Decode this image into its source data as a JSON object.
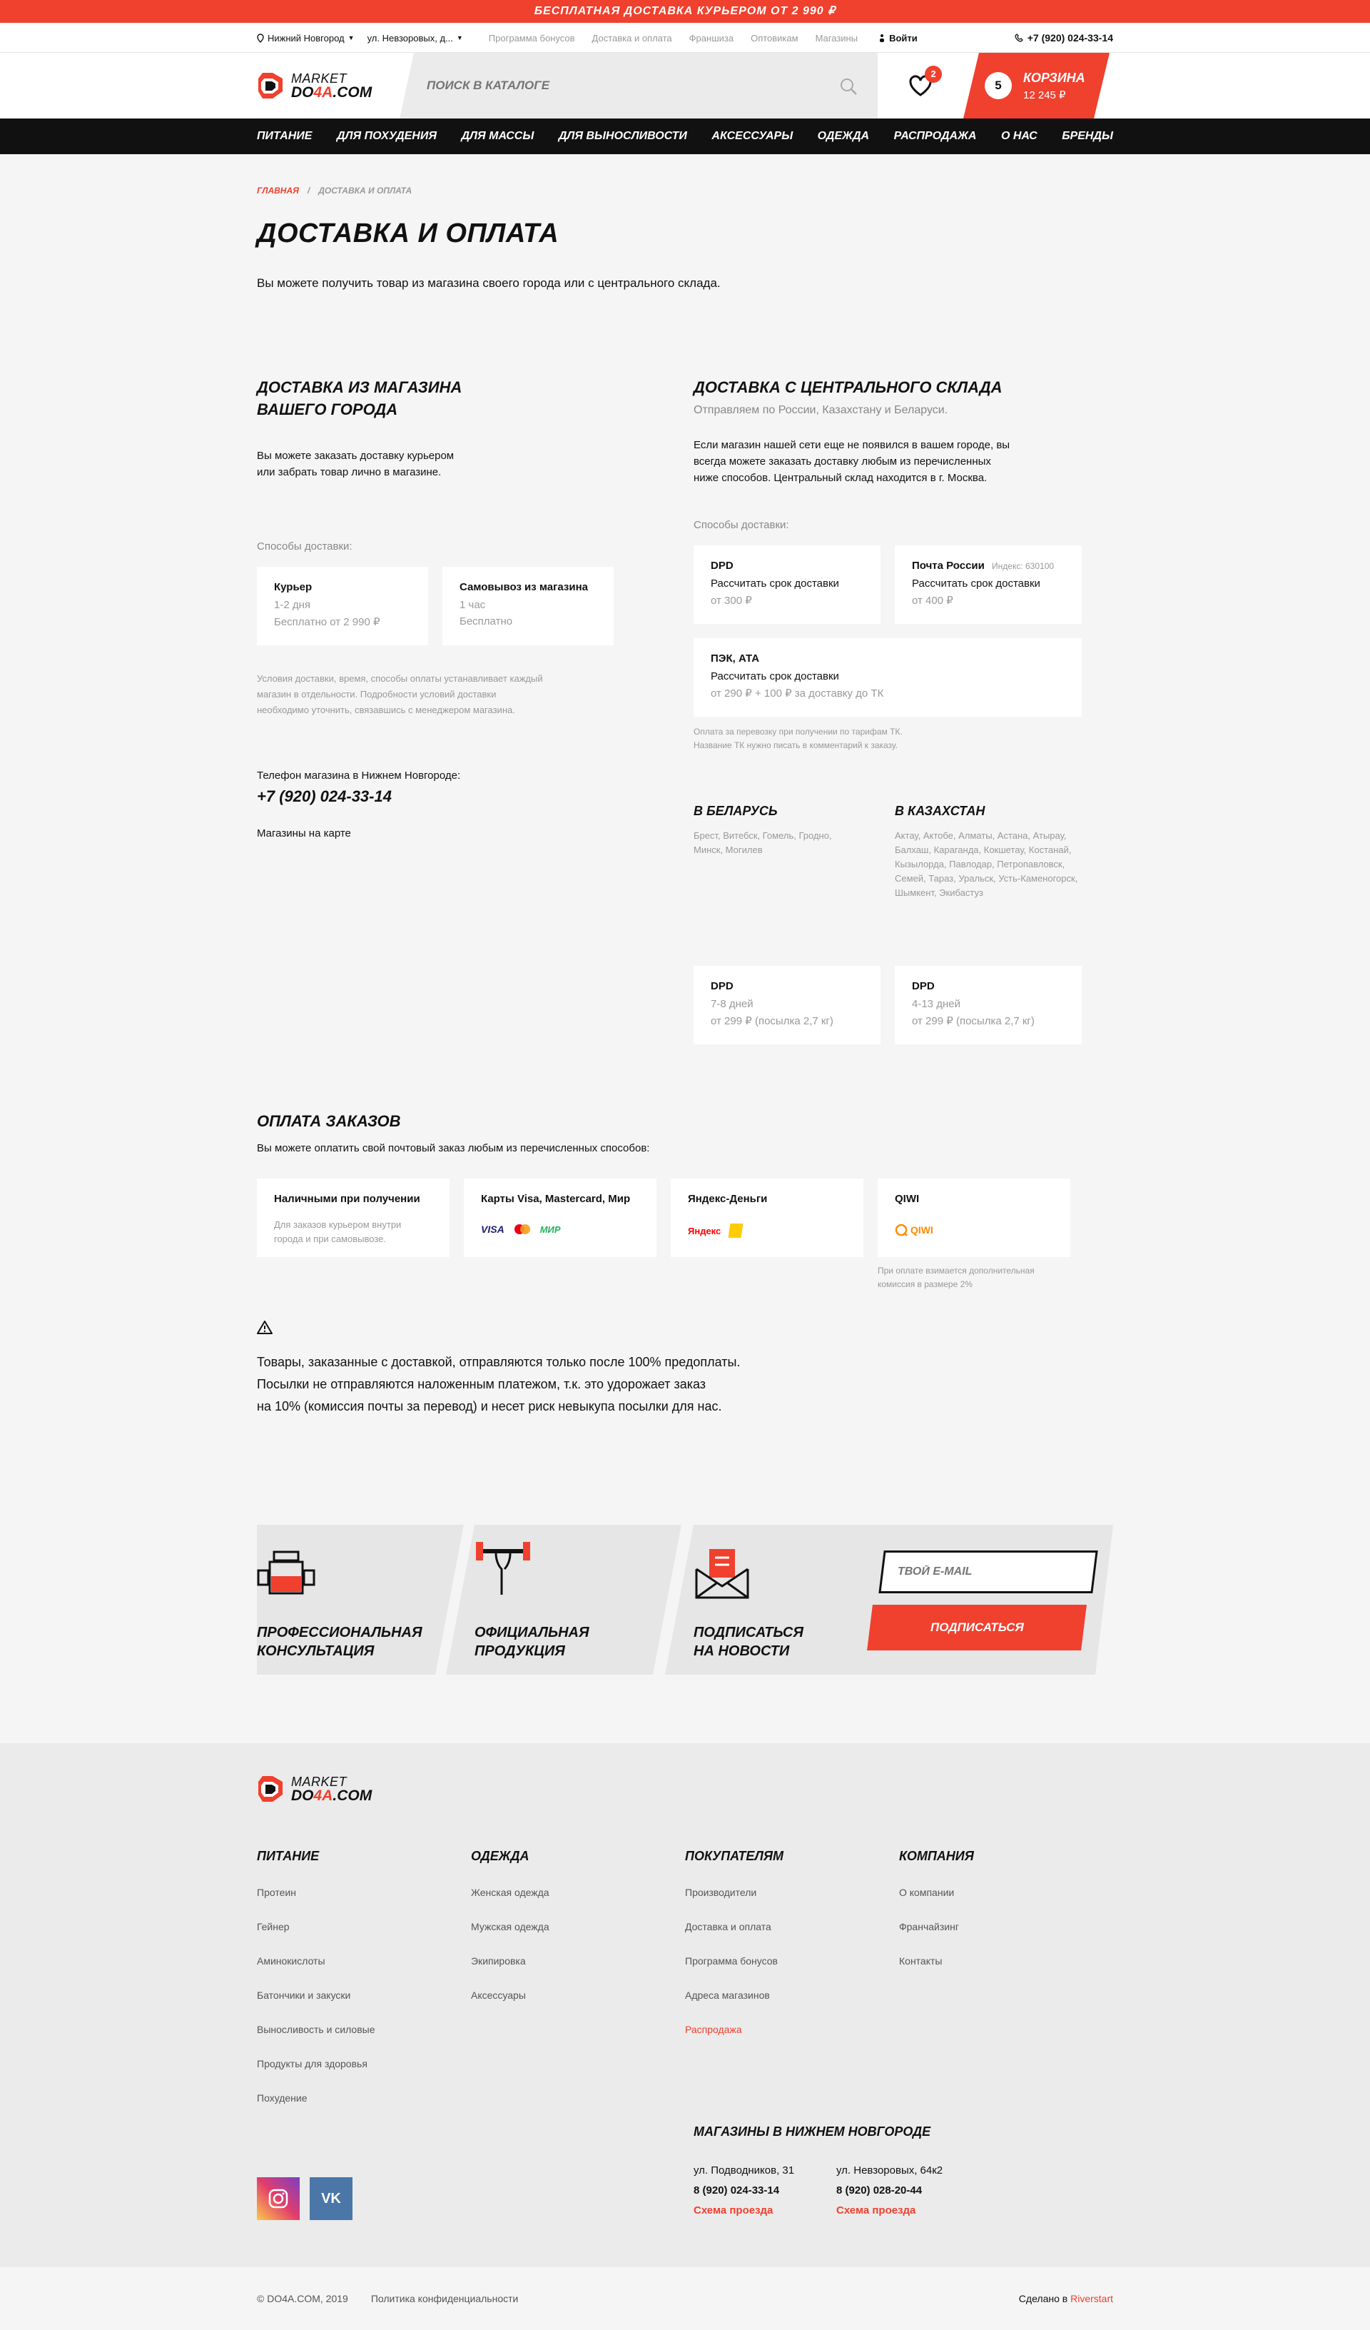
{
  "promo": "БЕСПЛАТНАЯ ДОСТАВКА КУРЬЕРОМ ОТ 2 990 ₽",
  "topbar": {
    "city": "Нижний Новгород",
    "address": "ул. Невзоровых, д...",
    "links": [
      "Программа бонусов",
      "Доставка и оплата",
      "Франшиза",
      "Оптовикам",
      "Магазины"
    ],
    "login": "Войти",
    "phone": "+7 (920) 024-33-14"
  },
  "header": {
    "logo_top": "MARKET",
    "logo_a": "DO",
    "logo_b": "4A",
    "logo_c": ".COM",
    "search_placeholder": "ПОИСК В КАТАЛОГЕ",
    "fav_count": "2",
    "cart_count": "5",
    "cart_label": "КОРЗИНА",
    "cart_sum": "12 245 ₽"
  },
  "nav": [
    "ПИТАНИЕ",
    "ДЛЯ ПОХУДЕНИЯ",
    "ДЛЯ МАССЫ",
    "ДЛЯ ВЫНОСЛИВОСТИ",
    "АКСЕССУАРЫ",
    "ОДЕЖДА",
    "РАСПРОДАЖА",
    "О НАС",
    "БРЕНДЫ"
  ],
  "breadcrumbs": {
    "home": "ГЛАВНАЯ",
    "sep": "/",
    "current": "ДОСТАВКА И ОПЛАТА"
  },
  "page": {
    "title": "ДОСТАВКА И ОПЛАТА",
    "intro": "Вы можете получить товар из магазина своего города или с центрального склада."
  },
  "local": {
    "title1": "ДОСТАВКА ИЗ МАГАЗИНА",
    "title2": "ВАШЕГО ГОРОДА",
    "text1": "Вы можете заказать доставку курьером",
    "text2": "или забрать товар лично в магазине.",
    "methods_label": "Способы доставки:",
    "cards": [
      {
        "title": "Курьер",
        "time": "1-2 дня",
        "price": "Бесплатно от 2 990 ₽"
      },
      {
        "title": "Самовывоз из магазина",
        "time": "1 час",
        "price": "Бесплатно"
      }
    ],
    "note1": "Условия доставки, время, способы оплаты устанавливает каждый",
    "note2": "магазин в отдельности. Подробности условий доставки",
    "note3": "необходимо уточнить, связавшись с менеджером магазина.",
    "phone_label": "Телефон магазина в Нижнем Новгороде:",
    "phone": "+7 (920) 024-33-14",
    "map_link": "Магазины на карте"
  },
  "central": {
    "title": "ДОСТАВКА С ЦЕНТРАЛЬНОГО СКЛАДА",
    "subtitle": "Отправляем по России, Казахстану и Беларуси.",
    "text1": "Если магазин нашей сети еще не появился в вашем городе, вы",
    "text2": "всегда можете заказать доставку любым из перечисленных",
    "text3": "ниже способов. Центральный склад находится в г. Москва.",
    "methods_label": "Способы доставки:",
    "dpd": {
      "title": "DPD",
      "action": "Рассчитать срок доставки",
      "price": "от 300 ₽"
    },
    "post": {
      "title": "Почта России",
      "index": "Индекс: 630100",
      "action": "Рассчитать срок доставки",
      "price": "от 400 ₽"
    },
    "pek": {
      "title": "ПЭК, АТА",
      "action": "Рассчитать срок доставки",
      "price": "от 290 ₽ + 100 ₽ за доставку до ТК"
    },
    "note1": "Оплата за перевозку при получении по тарифам ТК.",
    "note2": "Название ТК нужно писать в комментарий к заказу.",
    "belarus": {
      "title": "В БЕЛАРУСЬ",
      "cities1": "Брест, Витебск, Гомель, Гродно,",
      "cities2": "Минск, Могилев"
    },
    "kz": {
      "title": "В КАЗАХСТАН",
      "c1": "Актау, Актобе, Алматы, Астана, Атырау,",
      "c2": "Балхаш, Караганда, Кокшетау, Костанай,",
      "c3": "Кызылорда, Павлодар, Петропавловск,",
      "c4": "Семей, Тараз, Уральск, Усть-Каменогорск,",
      "c5": "Шымкент, Экибастуз"
    },
    "by_card": {
      "title": "DPD",
      "time": "7-8 дней",
      "price": "от 299 ₽ (посылка 2,7 кг)"
    },
    "kz_card": {
      "title": "DPD",
      "time": "4-13 дней",
      "price": "от 299 ₽ (посылка 2,7 кг)"
    }
  },
  "payment": {
    "title": "ОПЛАТА ЗАКАЗОВ",
    "intro": "Вы можете оплатить свой почтовый заказ любым из перечисленных способов:",
    "cards": [
      {
        "title": "Наличными при получении",
        "s1": "Для заказов курьером внутри",
        "s2": "города и при самовывозе."
      },
      {
        "title": "Карты Visa, Mastercard, Мир",
        "visa": "VISA",
        "mir": "МИР"
      },
      {
        "title": "Яндекс-Деньги",
        "ya": "Яндекс"
      },
      {
        "title": "QIWI",
        "qiwi": "QIWI"
      }
    ],
    "qiwi_note1": "При оплате взимается дополнительная",
    "qiwi_note2": "комиссия в размере 2%"
  },
  "warning": {
    "l1": "Товары, заказанные с доставкой, отправляются только после 100% предоплаты.",
    "l2": "Посылки не отправляются наложенным платежом, т.к. это удорожает заказ",
    "l3": "на 10% (комиссия почты за перевод) и несет риск невыкупа посылки для нас."
  },
  "features": [
    {
      "l1": "ПРОФЕССИОНАЛЬНАЯ",
      "l2": "КОНСУЛЬТАЦИЯ"
    },
    {
      "l1": "ОФИЦИАЛЬНАЯ",
      "l2": "ПРОДУКЦИЯ"
    },
    {
      "l1": "ПОДПИСАТЬСЯ",
      "l2": "НА НОВОСТИ"
    }
  ],
  "subscribe": {
    "placeholder": "ТВОЙ E-MAIL",
    "button": "ПОДПИСАТЬСЯ"
  },
  "footer": {
    "cols": [
      {
        "title": "ПИТАНИЕ",
        "items": [
          "Протеин",
          "Гейнер",
          "Аминокислоты",
          "Батончики и закуски",
          "Выносливость и силовые",
          "Продукты для здоровья",
          "Похудение"
        ]
      },
      {
        "title": "ОДЕЖДА",
        "items": [
          "Женская одежда",
          "Мужская одежда",
          "Экипировка",
          "Аксессуары"
        ]
      },
      {
        "title": "ПОКУПАТЕЛЯМ",
        "items": [
          "Производители",
          "Доставка и оплата",
          "Программа бонусов",
          "Адреса магазинов",
          "Распродажа"
        ]
      },
      {
        "title": "КОМПАНИЯ",
        "items": [
          "О компании",
          "Франчайзинг",
          "Контакты"
        ]
      }
    ],
    "stores_title": "МАГАЗИНЫ В НИЖНЕМ НОВГОРОДЕ",
    "stores": [
      {
        "addr": "ул. Подводников, 31",
        "phone": "8 (920) 024-33-14",
        "link": "Схема проезда"
      },
      {
        "addr": "ул. Невзоровых, 64к2",
        "phone": "8 (920) 028-20-44",
        "link": "Схема проезда"
      }
    ]
  },
  "bottom": {
    "copyright": "© DO4A.COM, 2019",
    "privacy": "Политика конфиденциальности",
    "made": "Сделано в",
    "made_by": "Riverstart"
  },
  "colors": {
    "accent": "#f0402e",
    "dark": "#111111",
    "bg": "#f5f5f5"
  }
}
